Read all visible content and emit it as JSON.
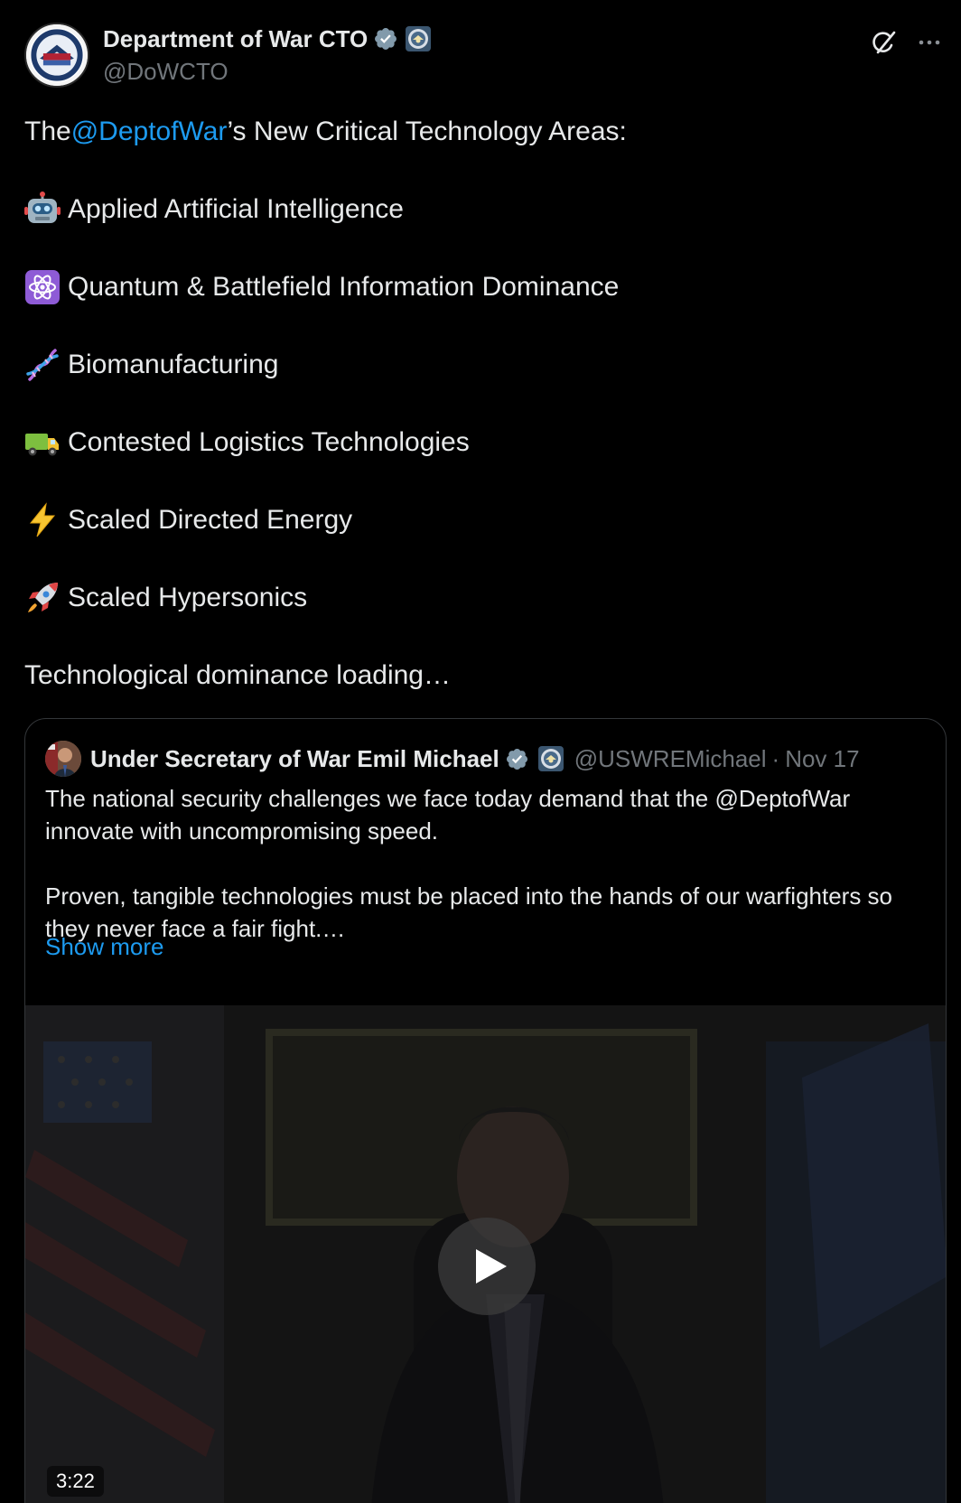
{
  "post": {
    "author": {
      "display_name": "Department of War CTO",
      "handle": "@DoWCTO",
      "verified_icon": "verified-badge-icon",
      "affiliation_icon": "dow-seal-icon"
    },
    "actions": {
      "grok_icon": "grok-icon",
      "more_icon": "more-icon"
    },
    "text": {
      "intro_prefix": "The ",
      "intro_mention": "@DeptofWar",
      "intro_suffix": "’s New Critical Technology Areas:",
      "items": [
        {
          "icon": "robot-emoji",
          "label": "Applied Artificial Intelligence"
        },
        {
          "icon": "atom-emoji",
          "label": "Quantum & Battlefield Information Dominance"
        },
        {
          "icon": "dna-emoji",
          "label": "Biomanufacturing"
        },
        {
          "icon": "truck-emoji",
          "label": "Contested Logistics Technologies"
        },
        {
          "icon": "lightning-emoji",
          "label": "Scaled Directed Energy"
        },
        {
          "icon": "rocket-emoji",
          "label": "Scaled Hypersonics"
        }
      ],
      "closing": "Technological dominance loading…"
    }
  },
  "quoted_post": {
    "display_name": "Under Secretary of War Emil Michael",
    "handle": "@USWREMichael",
    "separator": "·",
    "date": "Nov 17",
    "paragraph_1": "The national security challenges we face today demand that the @DeptofWar innovate with uncompromising speed.",
    "paragraph_2": "Proven, tangible technologies must be placed into the hands of our warfighters so they never face a fair fight.…",
    "show_more": "Show more",
    "video": {
      "duration": "3:22",
      "play_icon": "play-icon"
    }
  },
  "colors": {
    "background": "#000000",
    "text": "#e7e9ea",
    "secondary_text": "#71767b",
    "link": "#1d9bf0",
    "border": "#333639"
  }
}
